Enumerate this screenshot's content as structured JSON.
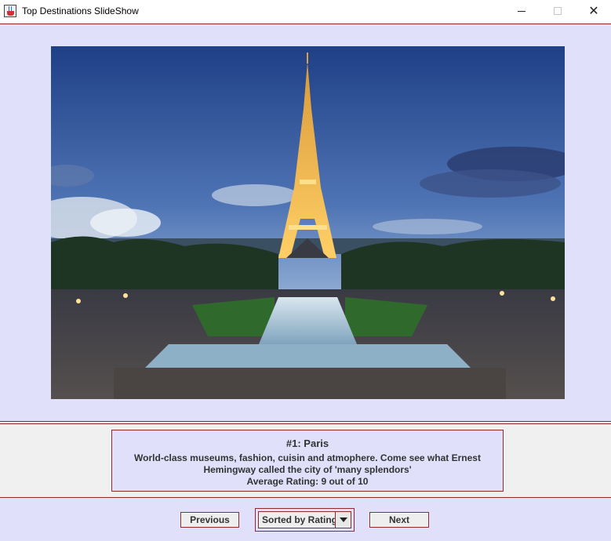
{
  "window": {
    "title": "Top Destinations SlideShow",
    "icon": "java-cup-icon",
    "controls": {
      "minimize": "minimize-icon",
      "maximize": "maximize-icon",
      "close": "✕"
    }
  },
  "slide": {
    "image": "eiffel-tower-photo",
    "heading": "#1: Paris",
    "description": "World-class museums, fashion, cuisin and atmophere. Come see what Ernest Hemingway called the city of 'many splendors'",
    "rating": "Average Rating: 9 out of 10"
  },
  "controls": {
    "previous_label": "Previous",
    "sort_selected": "Sorted by Rating",
    "next_label": "Next"
  },
  "colors": {
    "panel_background": "#e0e0fb",
    "border": "#8b2b2b",
    "text": "#333333"
  }
}
